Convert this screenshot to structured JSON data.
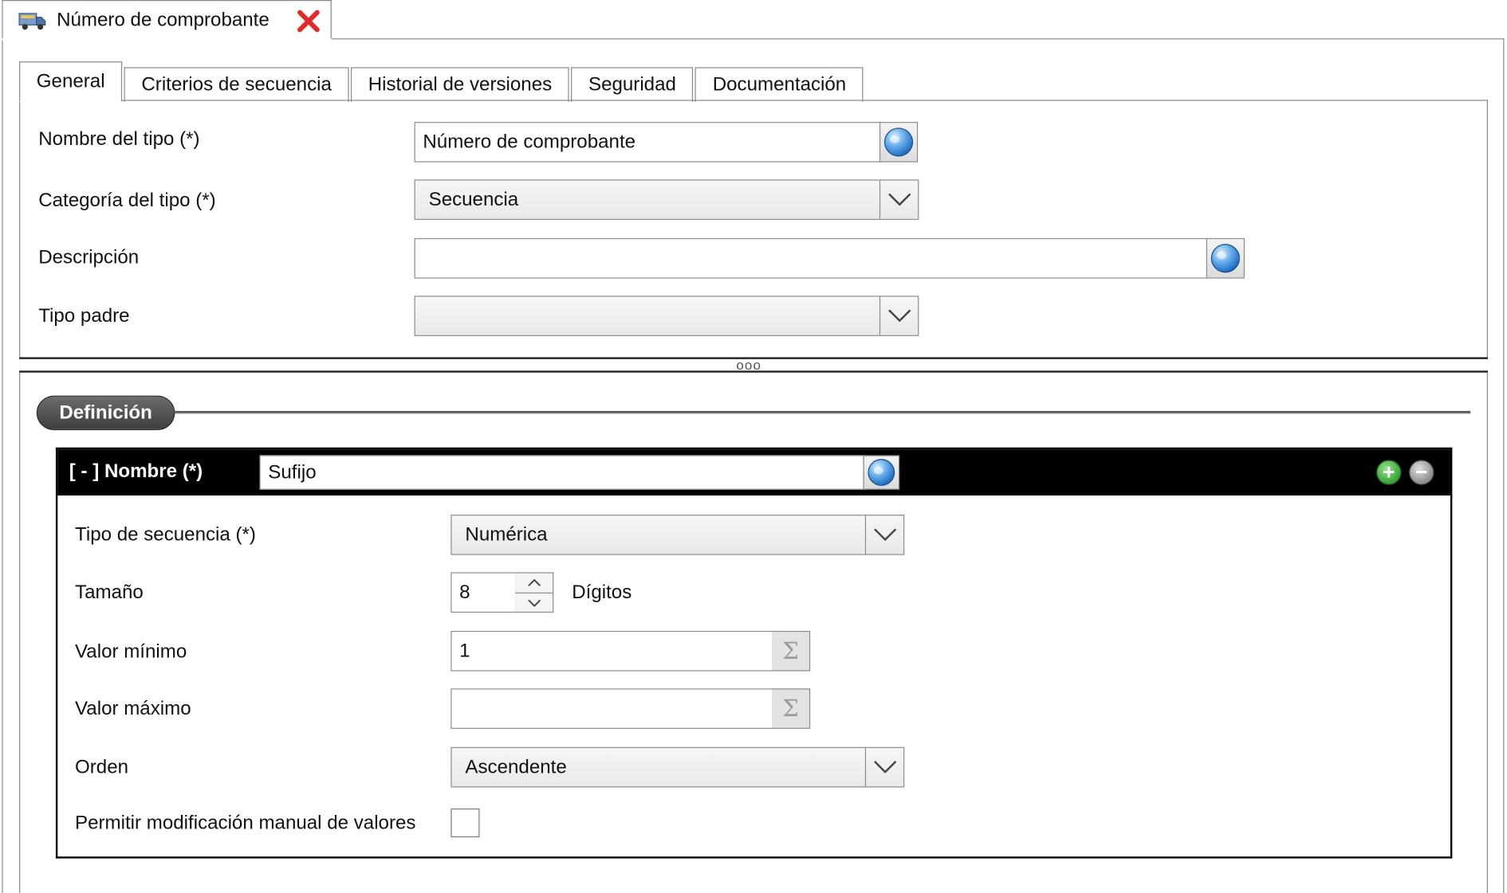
{
  "document_tab": {
    "icon": "truck-icon",
    "title": "Número de comprobante",
    "close_icon": "close-icon"
  },
  "tabs": [
    {
      "label": "General",
      "active": true
    },
    {
      "label": "Criterios de secuencia",
      "active": false
    },
    {
      "label": "Historial de versiones",
      "active": false
    },
    {
      "label": "Seguridad",
      "active": false
    },
    {
      "label": "Documentación",
      "active": false
    }
  ],
  "general": {
    "type_name": {
      "label": "Nombre del tipo (*)",
      "value": "Número de comprobante"
    },
    "type_category": {
      "label": "Categoría del tipo (*)",
      "value": "Secuencia"
    },
    "description": {
      "label": "Descripción",
      "value": ""
    },
    "parent_type": {
      "label": "Tipo padre",
      "value": ""
    }
  },
  "splitter": {
    "grip": "ooo"
  },
  "definition": {
    "section_title": "Definición",
    "header": {
      "title": "[ - ] Nombre (*)",
      "name_value": "Sufijo"
    },
    "sequence_type": {
      "label": "Tipo de secuencia (*)",
      "value": "Numérica"
    },
    "size": {
      "label": "Tamaño",
      "value": "8",
      "unit": "Dígitos"
    },
    "min_value": {
      "label": "Valor mínimo",
      "value": "1"
    },
    "max_value": {
      "label": "Valor máximo",
      "value": ""
    },
    "order": {
      "label": "Orden",
      "value": "Ascendente"
    },
    "manual_edit": {
      "label": "Permitir modificación manual de valores",
      "checked": false
    }
  },
  "colors": {
    "accent_add": "#3fae3f",
    "accent_remove": "#8a8a8a",
    "close_red": "#e02a2a"
  }
}
